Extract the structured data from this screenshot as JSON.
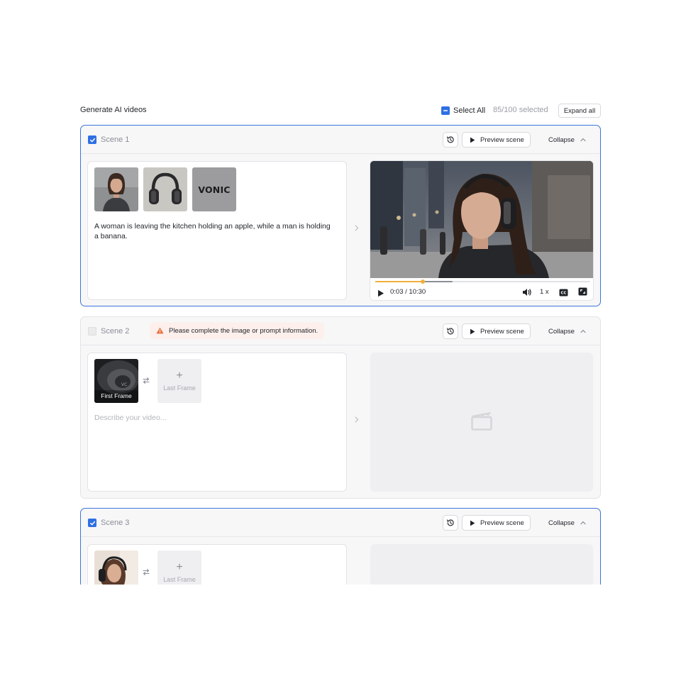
{
  "header": {
    "title": "Generate AI videos",
    "select_all_label": "Select All",
    "selected_count": "85/100 selected",
    "expand_all_label": "Expand all"
  },
  "colors": {
    "accent": "#2f6fe4",
    "warning": "#e8703f",
    "progress": "#f1b03c"
  },
  "scenes": [
    {
      "label": "Scene 1",
      "checked": true,
      "history_icon": "history-icon",
      "preview_label": "Preview scene",
      "collapse_label": "Collapse",
      "thumbnails": [
        "woman-portrait",
        "headphones-product",
        "vonic-logo"
      ],
      "logo_text": "VONIC",
      "prompt": "A woman is leaving the kitchen holding an apple, while a man is holding a banana.",
      "video": {
        "time": "0:03 / 10:30",
        "speed": "1 x",
        "progress": 0.22,
        "buffered": 0.36
      }
    },
    {
      "label": "Scene 2",
      "checked": false,
      "warning": "Please complete the image or prompt information.",
      "preview_label": "Preview scene",
      "collapse_label": "Collapse",
      "first_frame_label": "First Frame",
      "last_frame_label": "Last Frame",
      "prompt_placeholder": "Describe your video..."
    },
    {
      "label": "Scene 3",
      "checked": true,
      "preview_label": "Preview scene",
      "collapse_label": "Collapse",
      "last_frame_label": "Last Frame"
    }
  ]
}
